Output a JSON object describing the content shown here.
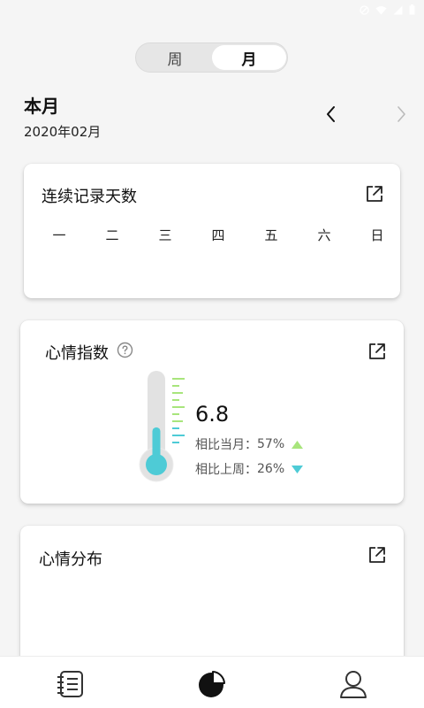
{
  "segment": {
    "week_label": "周",
    "month_label": "月",
    "selected": "month"
  },
  "period": {
    "title": "本月",
    "date": "2020年02月"
  },
  "streak_card": {
    "title": "连续记录天数",
    "weekdays": [
      "一",
      "二",
      "三",
      "四",
      "五",
      "六",
      "日"
    ]
  },
  "mood_card": {
    "title": "心情指数",
    "value": "6.8",
    "level": 0.43,
    "vs_month_label": "相比当月：",
    "vs_month_value": "57%",
    "vs_month_trend": "up",
    "vs_week_label": "相比上周：",
    "vs_week_value": "26%",
    "vs_week_trend": "down"
  },
  "distribution_card": {
    "title": "心情分布"
  },
  "bottom_nav": {
    "tabs": [
      "journal-icon",
      "stats-pie-icon",
      "profile-icon"
    ],
    "active": "stats-pie-icon"
  },
  "colors": {
    "teal": "#4ecbd6",
    "green": "#a8e57c",
    "gray": "#e2e2e2"
  }
}
